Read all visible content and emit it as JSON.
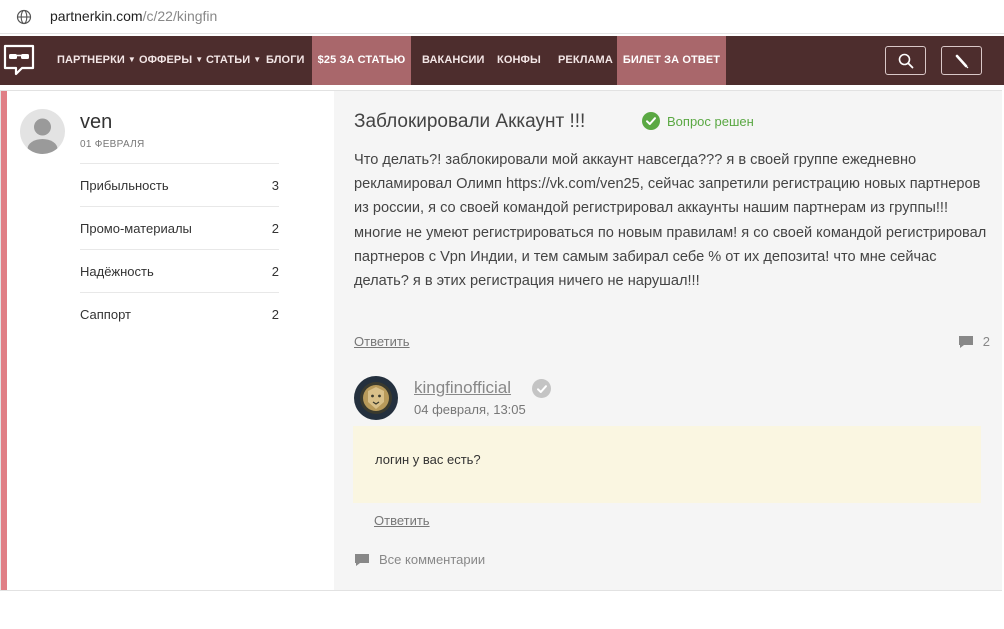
{
  "browser": {
    "url_host": "partnerkin.com",
    "url_path": "/c/22/kingfin"
  },
  "nav": {
    "items": [
      {
        "label": "ПАРТНЕРКИ",
        "caret": true
      },
      {
        "label": "ОФФЕРЫ",
        "caret": true
      },
      {
        "label": "СТАТЬИ",
        "caret": true
      },
      {
        "label": "БЛОГИ",
        "caret": false
      },
      {
        "label": "$25 ЗА СТАТЬЮ",
        "highlight": true
      },
      {
        "label": "ВАКАНСИИ"
      },
      {
        "label": "КОНФЫ"
      },
      {
        "label": "РЕКЛАМА"
      },
      {
        "label": "БИЛЕТ ЗА ОТВЕТ",
        "highlight": true
      }
    ],
    "icons": [
      "search-icon",
      "pen-icon"
    ],
    "colors": {
      "bg": "#4d2d2d",
      "highlight": "#a9676b"
    }
  },
  "author": {
    "name": "ven",
    "date": "01 ФЕВРАЛЯ",
    "ratings": [
      {
        "label": "Прибыльность",
        "value": "3"
      },
      {
        "label": "Промо-материалы",
        "value": "2"
      },
      {
        "label": "Надёжность",
        "value": "2"
      },
      {
        "label": "Саппорт",
        "value": "2"
      }
    ]
  },
  "question": {
    "title": "Заблокировали Аккаунт !!!",
    "status": "Вопрос решен",
    "body": "Что делать?! заблокировали мой аккаунт навсегда??? я в своей группе ежедневно рекламировал Олимп https://vk.com/ven25, сейчас запретили регистрацию новых партнеров из россии, я со своей командой регистрировал аккаунты нашим партнерам из группы!!! многие не умеют регистрироваться по новым правилам! я со своей командой регистрировал партнеров с Vpn Индии, и тем самым забирал себе % от их депозита! что мне сейчас делать? я в этих регистрация ничего не нарушал!!!",
    "reply_label": "Ответить",
    "comment_count": "2"
  },
  "answer": {
    "author": "kingfinofficial",
    "date": "04 февраля, 13:05",
    "text": "логин у вас есть?",
    "reply_label": "Ответить"
  },
  "footer": {
    "all_comments": "Все комментарии"
  },
  "colors": {
    "accent": "#e07f86",
    "solved": "#5aa843",
    "answer_bg": "#faf6e1"
  }
}
